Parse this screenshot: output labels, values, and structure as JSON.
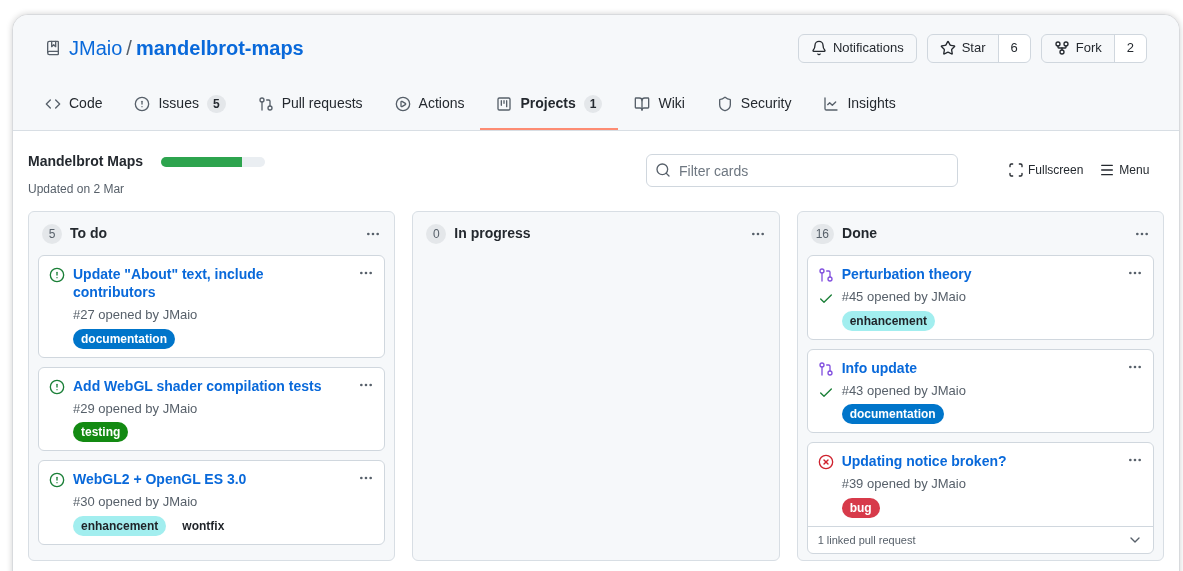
{
  "repo": {
    "owner": "JMaio",
    "separator": "/",
    "name": "mandelbrot-maps"
  },
  "repo_actions": [
    {
      "kind": "notifications",
      "label": "Notifications"
    },
    {
      "kind": "star",
      "label": "Star",
      "count": "6"
    },
    {
      "kind": "fork",
      "label": "Fork",
      "count": "2"
    }
  ],
  "tabs": [
    {
      "kind": "code",
      "label": "Code",
      "selected": false
    },
    {
      "kind": "issues",
      "label": "Issues",
      "count": "5",
      "selected": false
    },
    {
      "kind": "pulls",
      "label": "Pull requests",
      "selected": false
    },
    {
      "kind": "actions",
      "label": "Actions",
      "selected": false
    },
    {
      "kind": "projects",
      "label": "Projects",
      "count": "1",
      "selected": true
    },
    {
      "kind": "wiki",
      "label": "Wiki",
      "selected": false
    },
    {
      "kind": "security",
      "label": "Security",
      "selected": false
    },
    {
      "kind": "insights",
      "label": "Insights",
      "selected": false
    }
  ],
  "project": {
    "title": "Mandelbrot Maps",
    "level": 0.78,
    "updated": "Updated on 2 Mar",
    "filter_placeholder": "Filter cards",
    "fullscreen": "Fullscreen",
    "menu": "Menu"
  },
  "columns": [
    {
      "count": "5",
      "name": "To do",
      "cards": [
        {
          "kind": "issue_open",
          "title": "Update \"About\" text, include contributors",
          "meta": "#27 opened by JMaio",
          "checks_passed": false,
          "labels": [
            {
              "name": "documentation",
              "color": "#0075ca"
            }
          ]
        },
        {
          "kind": "issue_open",
          "title": "Add WebGL shader compilation tests",
          "meta": "#29 opened by JMaio",
          "checks_passed": false,
          "labels": [
            {
              "name": "testing",
              "color": "#138a12"
            }
          ]
        },
        {
          "kind": "issue_open",
          "title": "WebGL2 + OpenGL ES 3.0",
          "meta": "#30 opened by JMaio",
          "checks_passed": false,
          "labels": [
            {
              "name": "enhancement",
              "color": "#a2eeef"
            },
            {
              "name": "wontfix",
              "color": "#ffffff"
            }
          ]
        }
      ]
    },
    {
      "count": "0",
      "name": "In progress"
    },
    {
      "count": "16",
      "name": "Done",
      "cards": [
        {
          "kind": "pr_merged",
          "title": "Perturbation theory",
          "meta": "#45 opened by JMaio",
          "checks_passed": true,
          "labels": [
            {
              "name": "enhancement",
              "color": "#a2eeef"
            }
          ]
        },
        {
          "kind": "pr_merged",
          "title": "Info update",
          "meta": "#43 opened by JMaio",
          "checks_passed": true,
          "labels": [
            {
              "name": "documentation",
              "color": "#0075ca"
            }
          ]
        },
        {
          "kind": "issue_bug",
          "title": "Updating notice broken?",
          "meta": "#39 opened by JMaio",
          "checks_passed": false,
          "labels": [
            {
              "name": "bug",
              "color": "#d73a4a"
            }
          ],
          "footer": "1 linked pull request"
        }
      ]
    }
  ]
}
